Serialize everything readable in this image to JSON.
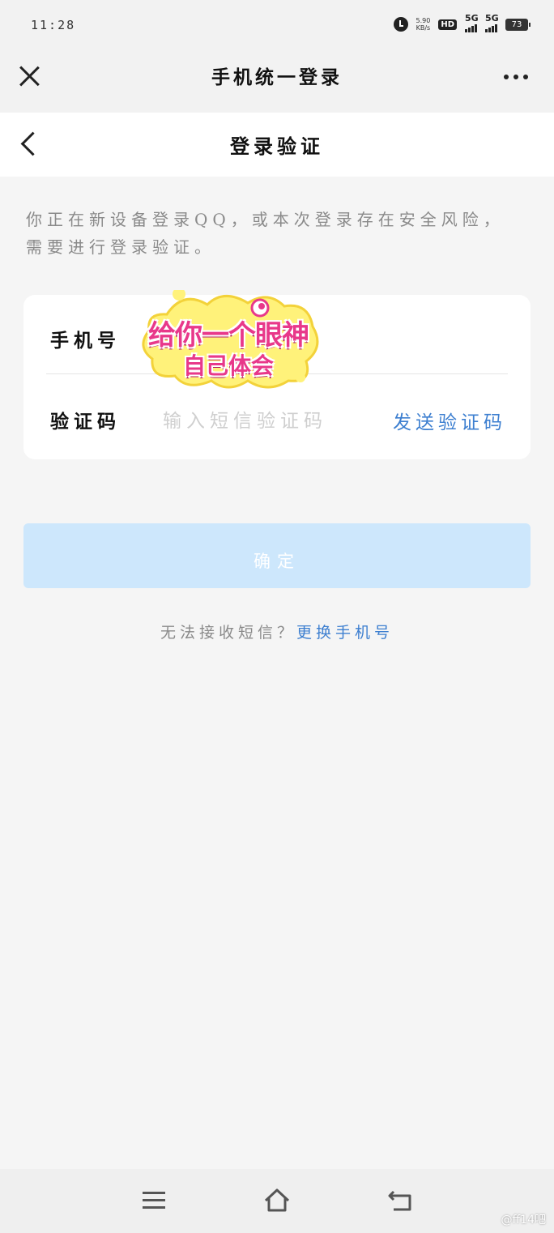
{
  "status_bar": {
    "time": "11:28",
    "net_speed_value": "5.90",
    "net_speed_unit": "KB/s",
    "hd_label": "HD",
    "signal1": "5G",
    "signal2": "5G",
    "battery": "73"
  },
  "title_bar": {
    "title": "手机统一登录",
    "close_icon": "close-icon",
    "more_icon": "more-icon"
  },
  "nav": {
    "title": "登录验证",
    "back_icon": "back-icon"
  },
  "notice": "你正在新设备登录QQ，或本次登录存在安全风险，需要进行登录验证。",
  "form": {
    "phone_label": "手机号",
    "code_label": "验证码",
    "code_placeholder": "输入短信验证码",
    "send_code": "发送验证码"
  },
  "sticker": {
    "line1": "给你一个眼神",
    "line2": "自己体会"
  },
  "confirm_button": "确定",
  "help": {
    "question": "无法接收短信？",
    "link": "更换手机号"
  },
  "system_nav": {
    "menu_icon": "menu-icon",
    "home_icon": "home-icon",
    "back_icon": "back-icon"
  },
  "watermark": "@ff14吧",
  "colors": {
    "accent": "#3d7fd0",
    "button_disabled": "#cde7fc",
    "sticker_pink": "#e8388a",
    "sticker_yellow": "#fff27a"
  }
}
